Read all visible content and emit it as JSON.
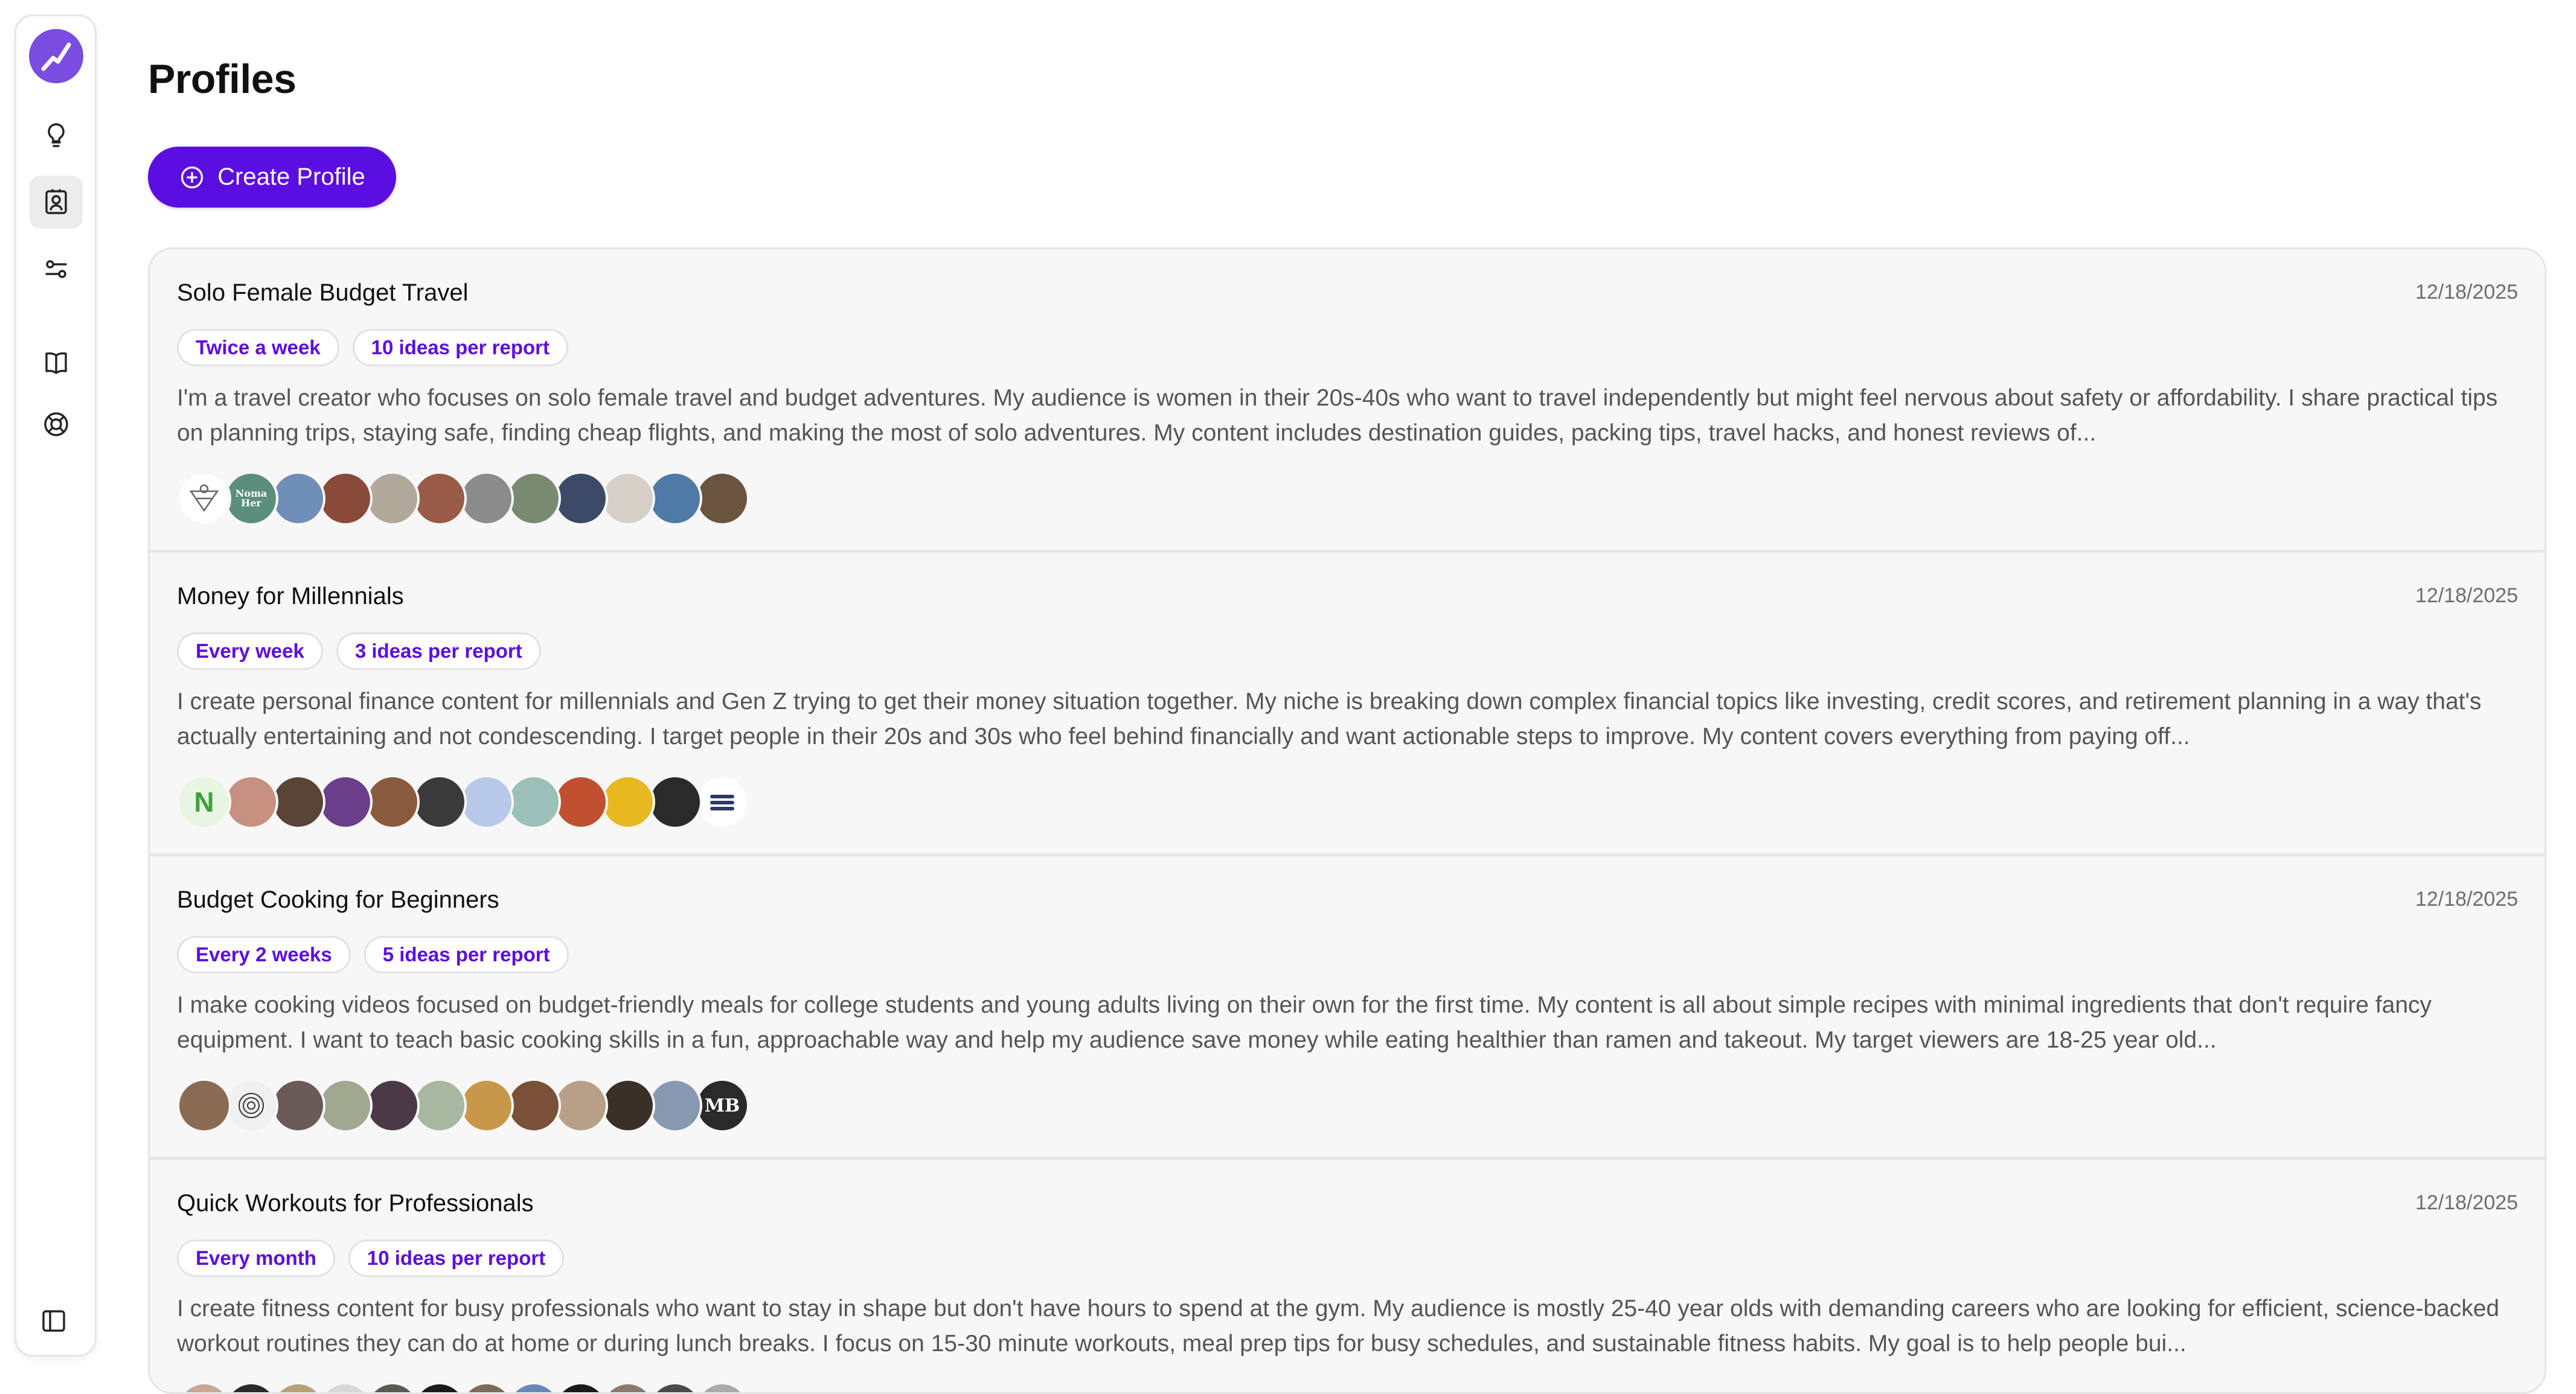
{
  "page": {
    "title": "Profiles",
    "create_button_label": "Create Profile"
  },
  "sidebar": {
    "items": [
      {
        "name": "logo",
        "icon": "trend-line-icon"
      },
      {
        "name": "ideas",
        "icon": "lightbulb-icon"
      },
      {
        "name": "profiles",
        "icon": "contact-card-icon",
        "active": true
      },
      {
        "name": "settings",
        "icon": "sliders-icon"
      },
      {
        "name": "docs",
        "icon": "book-icon"
      },
      {
        "name": "help",
        "icon": "lifebuoy-icon"
      },
      {
        "name": "collapse",
        "icon": "sidebar-toggle-icon"
      }
    ]
  },
  "colors": {
    "accent": "#5b0ee0",
    "logo": "#7a4de0"
  },
  "profiles": [
    {
      "name": "Solo Female Budget Travel",
      "date": "12/18/2025",
      "frequency": "Twice a week",
      "ideas": "10 ideas per report",
      "description": "I'm a travel creator who focuses on solo female travel and budget adventures. My audience is women in their 20s-40s who want to travel independently but might feel nervous about safety or affordability. I share practical tips on planning trips, staying safe, finding cheap flights, and making the most of solo adventures. My content includes destination guides, packing tips, travel hacks, and honest reviews of...",
      "avatars": [
        {
          "color": "#ffffff",
          "text": "",
          "icon": "geometric-logo"
        },
        {
          "color": "#5b8f7c",
          "text": "Noma Her"
        },
        {
          "color": "#6f8fb8",
          "text": ""
        },
        {
          "color": "#8a4a3a",
          "text": ""
        },
        {
          "color": "#b0a898",
          "text": ""
        },
        {
          "color": "#9a5a48",
          "text": ""
        },
        {
          "color": "#8c8c8c",
          "text": ""
        },
        {
          "color": "#7a8a70",
          "text": ""
        },
        {
          "color": "#3c4a68",
          "text": ""
        },
        {
          "color": "#d6d0c8",
          "text": ""
        },
        {
          "color": "#4f7aa8",
          "text": ""
        },
        {
          "color": "#6a5440",
          "text": ""
        }
      ]
    },
    {
      "name": "Money for Millennials",
      "date": "12/18/2025",
      "frequency": "Every week",
      "ideas": "3 ideas per report",
      "description": "I create personal finance content for millennials and Gen Z trying to get their money situation together. My niche is breaking down complex financial topics like investing, credit scores, and retirement planning in a way that's actually entertaining and not condescending. I target people in their 20s and 30s who feel behind financially and want actionable steps to improve. My content covers everything from paying off...",
      "avatars": [
        {
          "color": "#e8f5e0",
          "text": "N",
          "textColor": "#3aa23a"
        },
        {
          "color": "#c89080",
          "text": ""
        },
        {
          "color": "#5a4438",
          "text": ""
        },
        {
          "color": "#6a3e8a",
          "text": ""
        },
        {
          "color": "#8a5a3c",
          "text": ""
        },
        {
          "color": "#3a3a3a",
          "text": ""
        },
        {
          "color": "#b8c8e8",
          "text": ""
        },
        {
          "color": "#9ac0b8",
          "text": ""
        },
        {
          "color": "#c05030",
          "text": ""
        },
        {
          "color": "#e8b820",
          "text": ""
        },
        {
          "color": "#2a2a2a",
          "text": ""
        },
        {
          "color": "#ffffff",
          "text": "",
          "icon": "stripes-logo"
        }
      ]
    },
    {
      "name": "Budget Cooking for Beginners",
      "date": "12/18/2025",
      "frequency": "Every 2 weeks",
      "ideas": "5 ideas per report",
      "description": "I make cooking videos focused on budget-friendly meals for college students and young adults living on their own for the first time. My content is all about simple recipes with minimal ingredients that don't require fancy equipment. I want to teach basic cooking skills in a fun, approachable way and help my audience save money while eating healthier than ramen and takeout. My target viewers are 18-25 year old...",
      "avatars": [
        {
          "color": "#8a6a50",
          "text": ""
        },
        {
          "color": "#f0f0f0",
          "text": "",
          "icon": "spiral-logo"
        },
        {
          "color": "#6a5a58",
          "text": ""
        },
        {
          "color": "#a0a890",
          "text": ""
        },
        {
          "color": "#4a3a48",
          "text": ""
        },
        {
          "color": "#a8b8a0",
          "text": ""
        },
        {
          "color": "#c89848",
          "text": ""
        },
        {
          "color": "#7a5038",
          "text": ""
        },
        {
          "color": "#b8a088",
          "text": ""
        },
        {
          "color": "#3a3028",
          "text": ""
        },
        {
          "color": "#8898b0",
          "text": ""
        },
        {
          "color": "#2a2a2a",
          "text": "MB"
        }
      ]
    },
    {
      "name": "Quick Workouts for Professionals",
      "date": "12/18/2025",
      "frequency": "Every month",
      "ideas": "10 ideas per report",
      "description": "I create fitness content for busy professionals who want to stay in shape but don't have hours to spend at the gym. My audience is mostly 25-40 year olds with demanding careers who are looking for efficient, science-backed workout routines they can do at home or during lunch breaks. I focus on 15-30 minute workouts, meal prep tips for busy schedules, and sustainable fitness habits. My goal is to help people bui...",
      "avatars": [
        {
          "color": "#c8a890",
          "text": ""
        },
        {
          "color": "#2a2a2a",
          "text": ""
        },
        {
          "color": "#b8a078",
          "text": ""
        },
        {
          "color": "#d8d8d8",
          "text": ""
        },
        {
          "color": "#5a5a50",
          "text": ""
        },
        {
          "color": "#1a1a1a",
          "text": ""
        },
        {
          "color": "#7a6a5a",
          "text": ""
        },
        {
          "color": "#6888b8",
          "text": ""
        },
        {
          "color": "#1a1a1a",
          "text": ""
        },
        {
          "color": "#8a7a6a",
          "text": ""
        },
        {
          "color": "#4a4a4a",
          "text": ""
        },
        {
          "color": "#aaaaaa",
          "text": ""
        }
      ]
    }
  ]
}
